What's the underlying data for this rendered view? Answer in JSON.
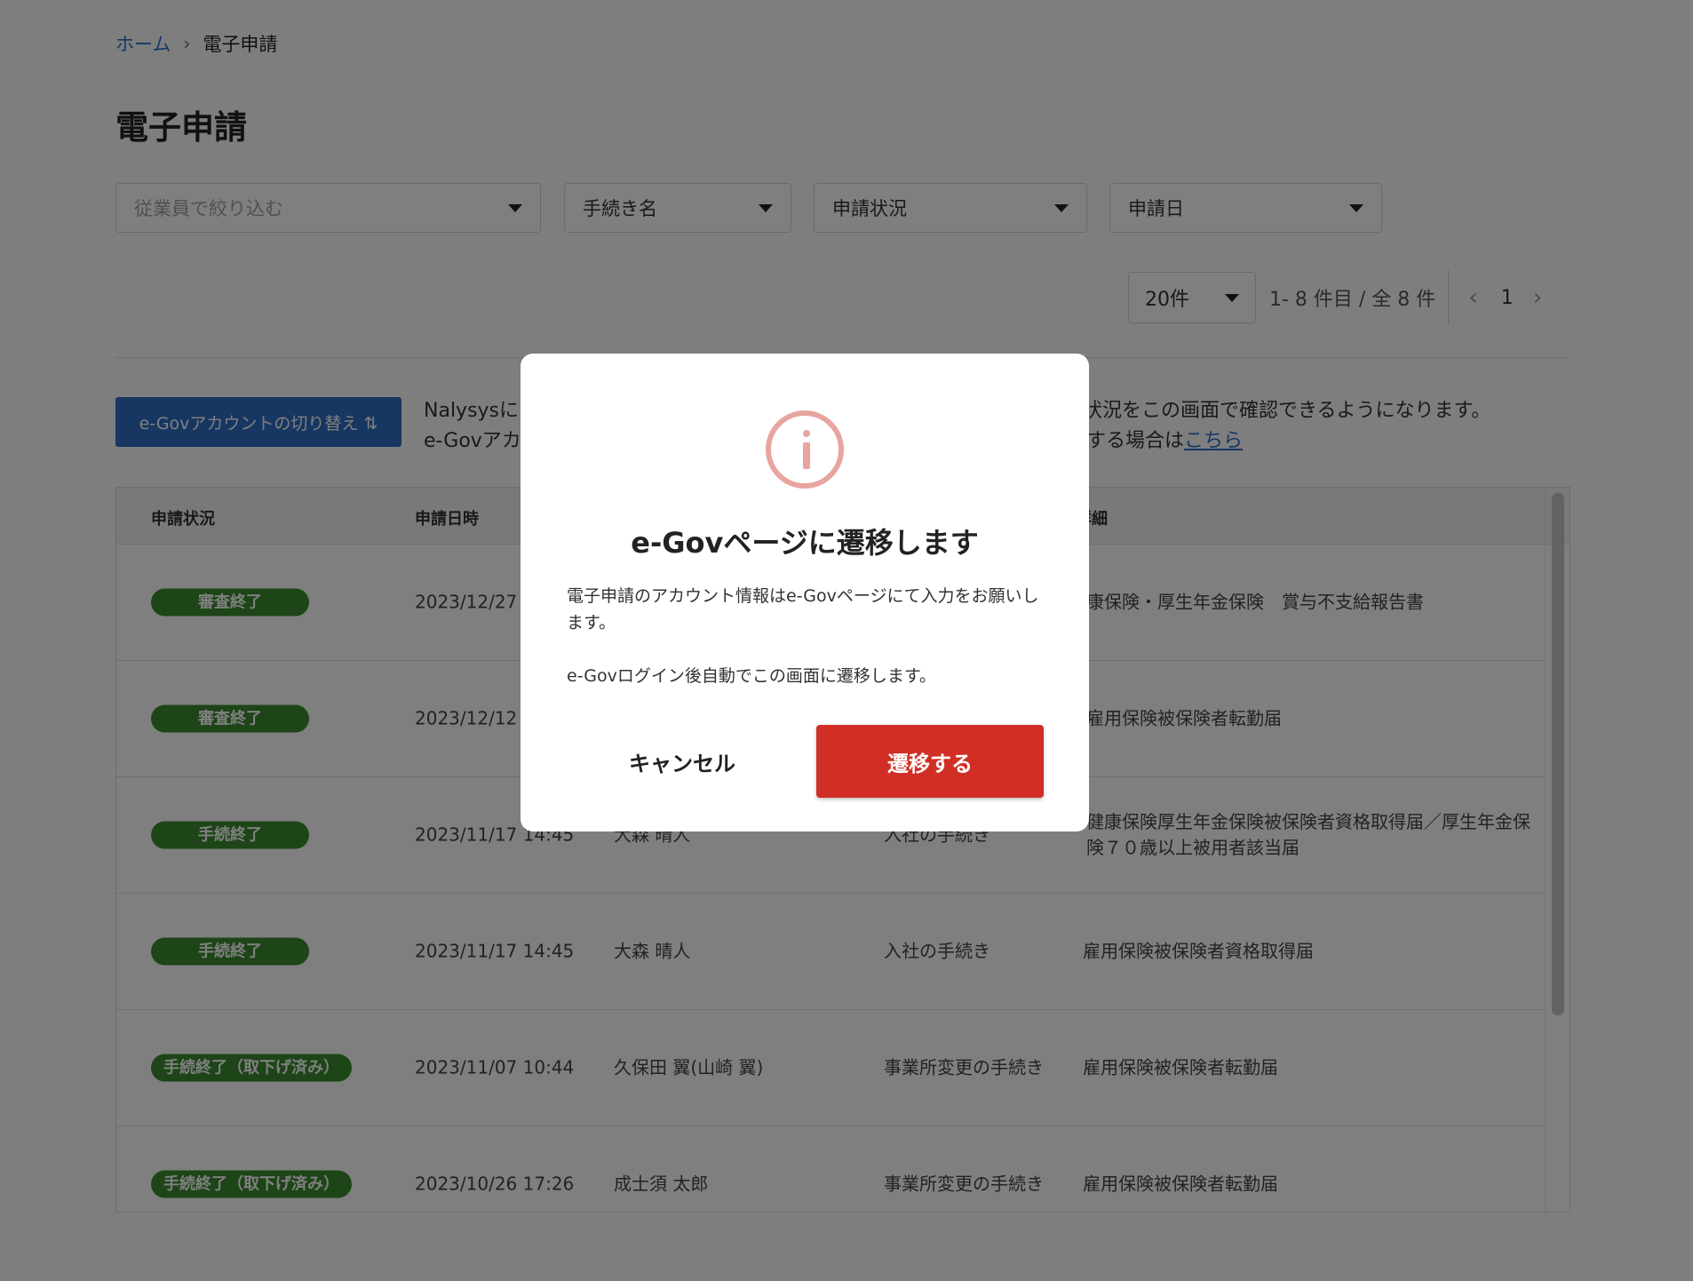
{
  "breadcrumb": {
    "home": "ホーム",
    "current": "電子申請"
  },
  "page_title": "電子申請",
  "filters": {
    "employee_placeholder": "従業員で絞り込む",
    "procedure": "手続き名",
    "status": "申請状況",
    "date": "申請日"
  },
  "pager": {
    "per_page": "20件",
    "range": "1- 8 件目 /  全 8 件",
    "page": "1"
  },
  "switch_button": "e-Govアカウントの切り替え ⇅",
  "info": {
    "line1_a": "Nalysysに",
    "line1_b": "状況をこの画面で確認できるようになります。",
    "line2_a": "e-Govアカ",
    "line2_b": "する場合は",
    "link": "こちら"
  },
  "table": {
    "headers": {
      "status": "申請状況",
      "datetime": "申請日時",
      "details": "詳細"
    },
    "rows": [
      {
        "status": "審査終了",
        "datetime": "2023/12/27",
        "employee": "",
        "procedure": "",
        "details": "康保険・厚生年金保険　賞与不支給報告書"
      },
      {
        "status": "審査終了",
        "datetime": "2023/12/12",
        "employee": "",
        "procedure": "",
        "details": "雇用保険被保険者転勤届"
      },
      {
        "status": "手続終了",
        "datetime": "2023/11/17 14:45",
        "employee": "大森 晴人",
        "procedure": "入社の手続き",
        "details": "健康保険厚生年金保険被保険者資格取得届／厚生年金保険７０歳以上被用者該当届"
      },
      {
        "status": "手続終了",
        "datetime": "2023/11/17 14:45",
        "employee": "大森 晴人",
        "procedure": "入社の手続き",
        "details": "雇用保険被保険者資格取得届"
      },
      {
        "status": "手続終了（取下げ済み）",
        "datetime": "2023/11/07 10:44",
        "employee": "久保田 翼(山崎 翼)",
        "procedure": "事業所変更の手続き",
        "details": "雇用保険被保険者転勤届"
      },
      {
        "status": "手続終了（取下げ済み）",
        "datetime": "2023/10/26 17:26",
        "employee": "成士須 太郎",
        "procedure": "事業所変更の手続き",
        "details": "雇用保険被保険者転勤届"
      }
    ]
  },
  "modal": {
    "icon": "info-icon",
    "title": "e-Govページに遷移します",
    "body1": "電子申請のアカウント情報はe-Govページにて入力をお願いします。",
    "body2": "e-Govログイン後自動でこの画面に遷移します。",
    "cancel": "キャンセル",
    "confirm": "遷移する"
  },
  "colors": {
    "accent_blue": "#2e6fc4",
    "status_green": "#3a8a2e",
    "confirm_red": "#d12f25",
    "icon_pink": "#e8a49f"
  }
}
